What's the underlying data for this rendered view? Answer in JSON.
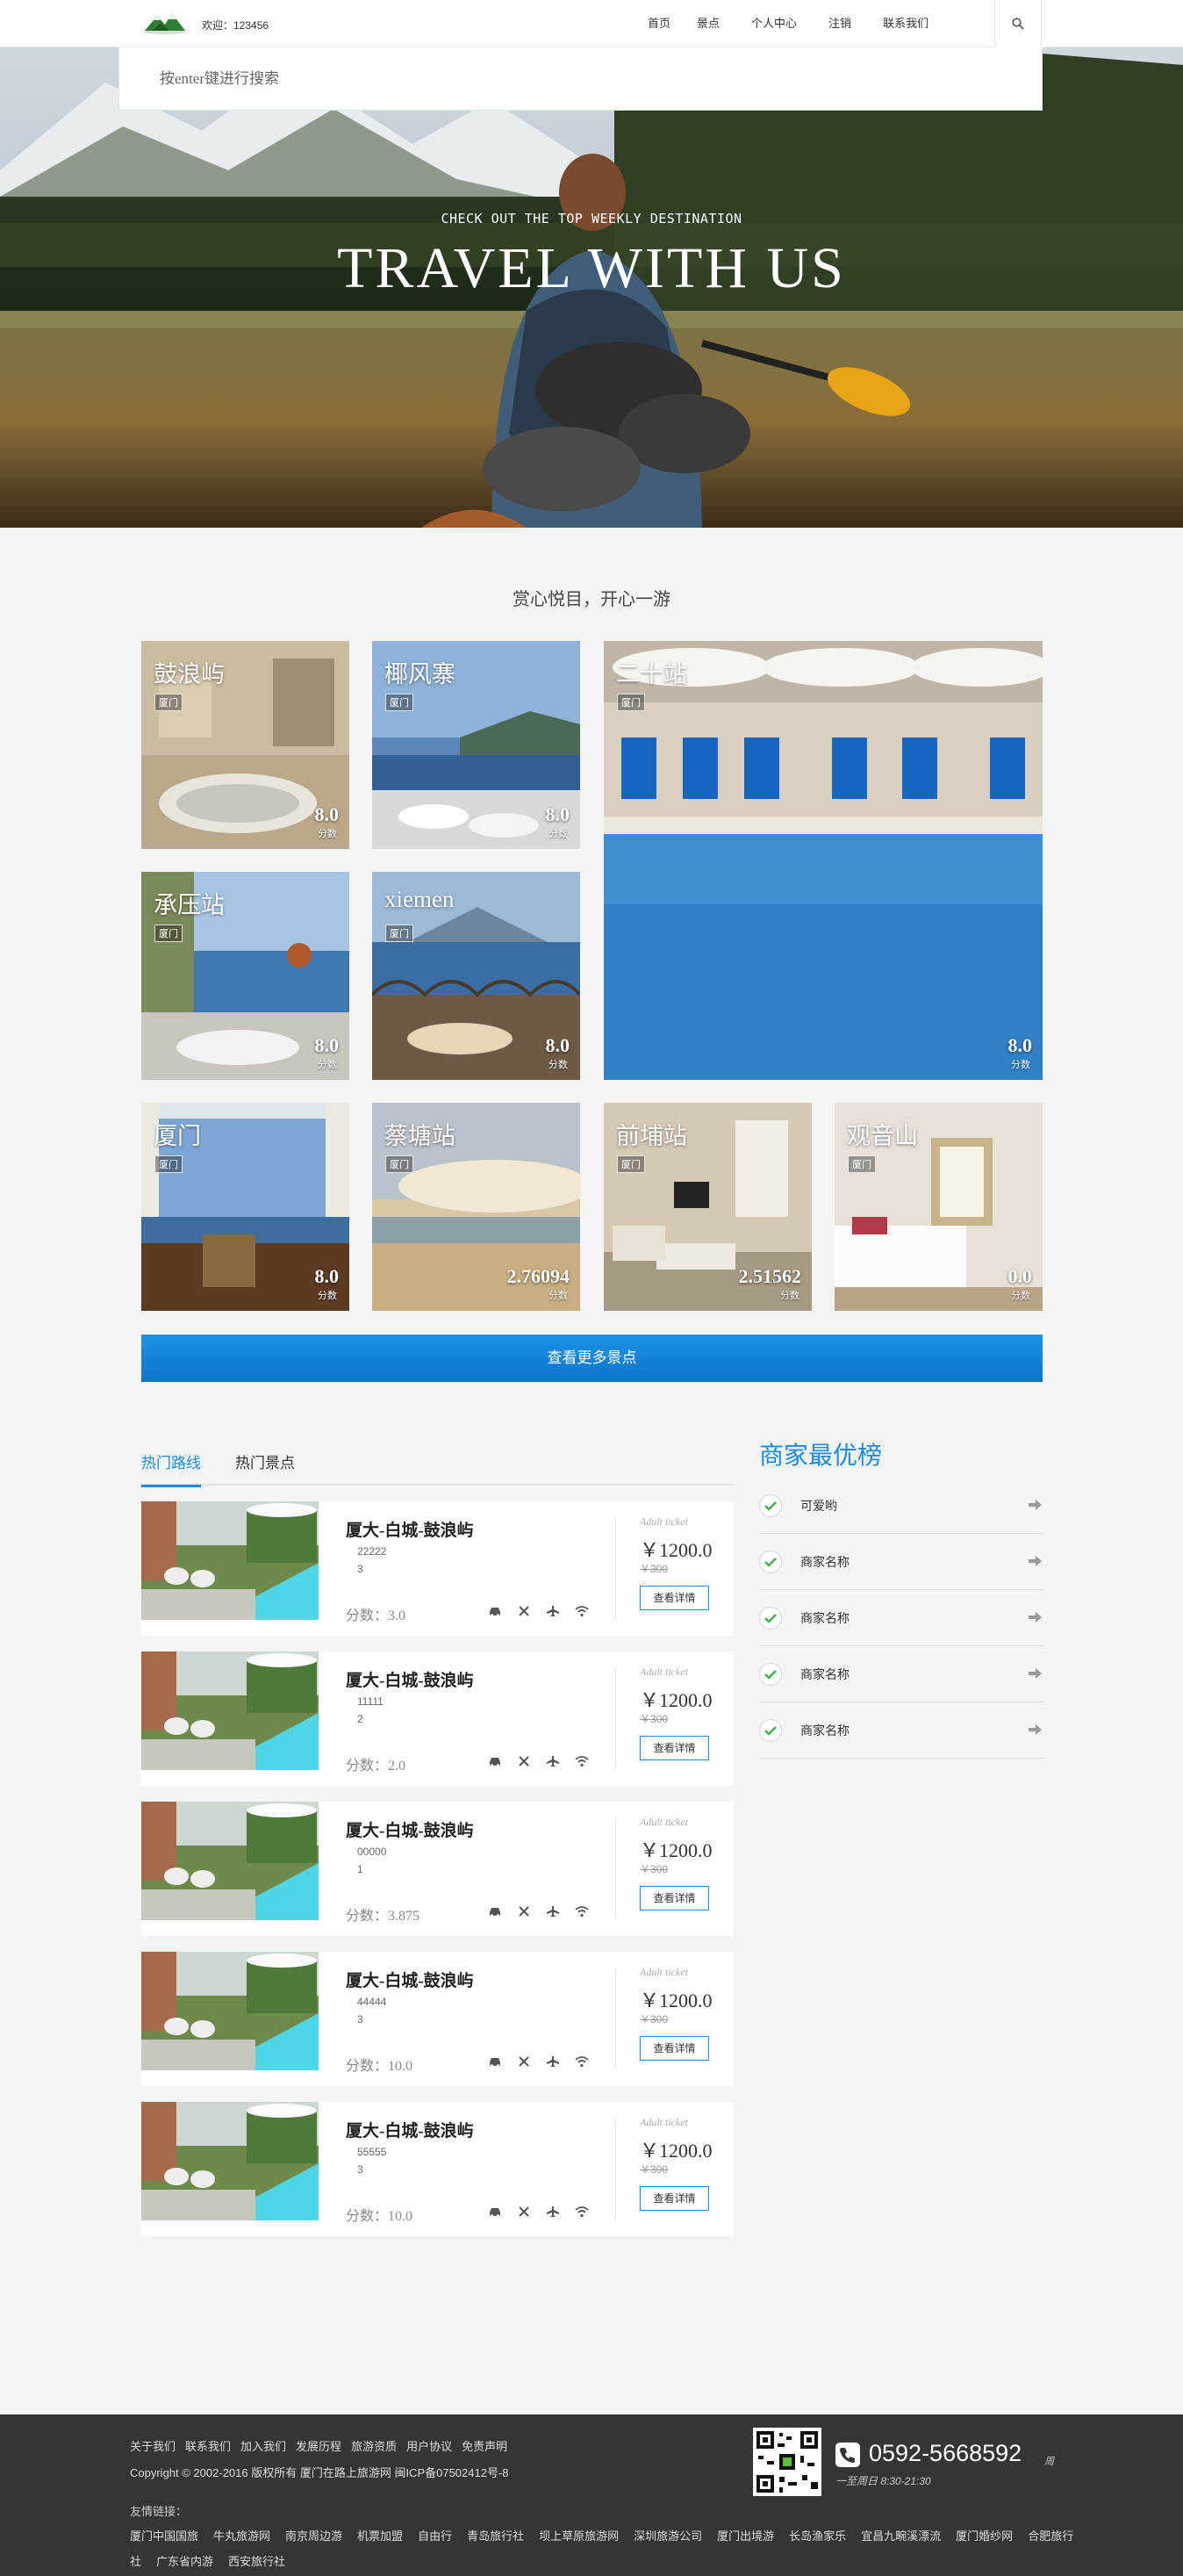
{
  "header": {
    "welcome": "欢迎：123456",
    "nav": [
      "首页",
      "景点",
      "个人中心",
      "注销",
      "联系我们"
    ]
  },
  "search": {
    "placeholder": "按enter键进行搜索"
  },
  "hero": {
    "subtitle": "CHECK OUT THE TOP WEEKLY DESTINATION",
    "title": "TRAVEL WITH US"
  },
  "destinations": {
    "heading": "赏心悦目，开心一游",
    "score_unit": "分数",
    "items": [
      {
        "name": "鼓浪屿",
        "tag": "厦门",
        "score": "8.0"
      },
      {
        "name": "椰风寨",
        "tag": "厦门",
        "score": "8.0"
      },
      {
        "name": "二十站",
        "tag": "厦门",
        "score": "8.0"
      },
      {
        "name": "承压站",
        "tag": "厦门",
        "score": "8.0"
      },
      {
        "name": "xiemen",
        "tag": "厦门",
        "score": "8.0"
      },
      {
        "name": "厦门",
        "tag": "厦门",
        "score": "8.0"
      },
      {
        "name": "蔡塘站",
        "tag": "厦门",
        "score": "2.76094"
      },
      {
        "name": "前埔站",
        "tag": "厦门",
        "score": "2.51562"
      },
      {
        "name": "观音山",
        "tag": "厦门",
        "score": "0.0"
      }
    ],
    "more_button": "查看更多景点"
  },
  "tabs": [
    "热门路线",
    "热门景点"
  ],
  "routes": [
    {
      "title": "厦大-白城-鼓浪屿",
      "desc": "22222",
      "num": "3",
      "score": "分数：3.0",
      "ticket": "Adult ticket",
      "price": "￥1200.0",
      "old_price": "￥300",
      "button": "查看详情"
    },
    {
      "title": "厦大-白城-鼓浪屿",
      "desc": "11111",
      "num": "2",
      "score": "分数：2.0",
      "ticket": "Adult ticket",
      "price": "￥1200.0",
      "old_price": "￥300",
      "button": "查看详情"
    },
    {
      "title": "厦大-白城-鼓浪屿",
      "desc": "00000",
      "num": "1",
      "score": "分数：3.875",
      "ticket": "Adult ticket",
      "price": "￥1200.0",
      "old_price": "￥300",
      "button": "查看详情"
    },
    {
      "title": "厦大-白城-鼓浪屿",
      "desc": "44444",
      "num": "3",
      "score": "分数：10.0",
      "ticket": "Adult ticket",
      "price": "￥1200.0",
      "old_price": "￥300",
      "button": "查看详情"
    },
    {
      "title": "厦大-白城-鼓浪屿",
      "desc": "55555",
      "num": "3",
      "score": "分数：10.0",
      "ticket": "Adult ticket",
      "price": "￥1200.0",
      "old_price": "￥300",
      "button": "查看详情"
    }
  ],
  "merchants": {
    "title": "商家最优榜",
    "items": [
      "可爱哟",
      "商家名称",
      "商家名称",
      "商家名称",
      "商家名称"
    ]
  },
  "footer": {
    "links": [
      "关于我们",
      "联系我们",
      "加入我们",
      "发展历程",
      "旅游资质",
      "用户协议",
      "免责声明"
    ],
    "copyright": "Copyright © 2002-2016  版权所有  厦门在路上旅游网    闽ICP备07502412号-8",
    "friend_label": "友情链接：",
    "friend_links": [
      "厦门中国国旅",
      "牛丸旅游网",
      "南京周边游",
      "机票加盟",
      "自由行",
      "青岛旅行社",
      "坝上草原旅游网",
      "深圳旅游公司",
      "厦门出境游",
      "长岛渔家乐",
      "宜昌九畹溪漂流",
      "厦门婚纱网",
      "合肥旅行社",
      "广东省内游",
      "西安旅行社"
    ],
    "phone": "0592-5668592",
    "week": "周",
    "hours": "一至周日    8:30-21:30"
  },
  "colors": {
    "accent": "#1a8be0",
    "footer_bg": "#353535"
  }
}
